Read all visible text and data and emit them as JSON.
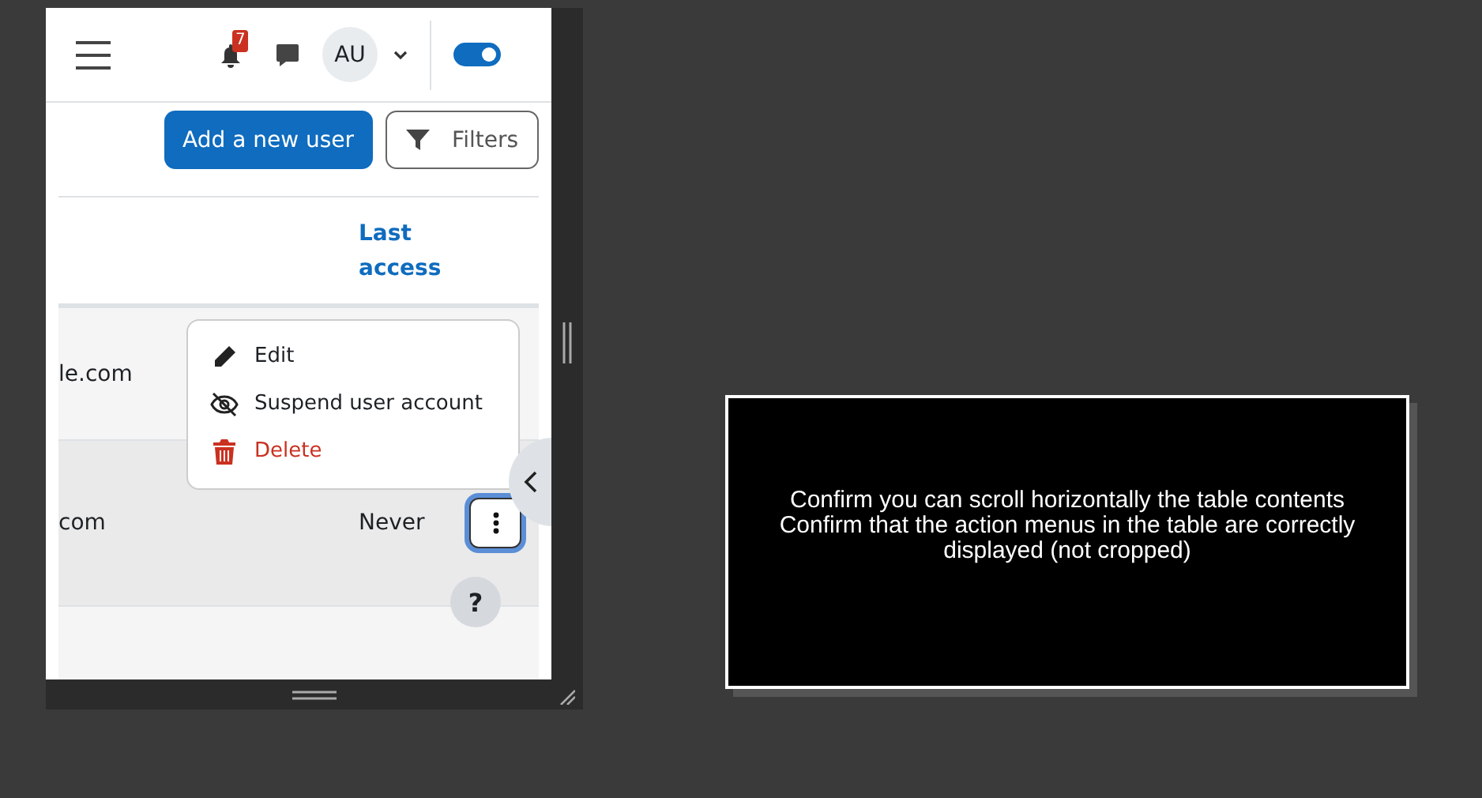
{
  "navbar": {
    "notification_count": "7",
    "avatar_initials": "AU",
    "edit_mode": {
      "on": true
    }
  },
  "actions": [
    {
      "label": "Add a new user",
      "kind": "primary"
    },
    {
      "label": "Filters",
      "kind": "filter"
    }
  ],
  "table": {
    "columns": [
      {
        "label": "Last access"
      }
    ],
    "rows": [
      {
        "column_1": "le.com",
        "highlighted": false
      },
      {
        "column_1": "com",
        "last_access": "Never",
        "highlighted": true
      },
      {
        "highlighted": false
      }
    ]
  },
  "action_menu": {
    "items": [
      {
        "label": "Edit",
        "kind": "edit"
      },
      {
        "label": "Suspend user account",
        "kind": "suspend"
      },
      {
        "label": "Delete",
        "kind": "delete"
      }
    ]
  },
  "help_button": {
    "label": "?"
  },
  "instructions": [
    "Confirm you can scroll horizontally the table contents",
    "Confirm that the action menus in the table are correctly displayed (not cropped)"
  ]
}
